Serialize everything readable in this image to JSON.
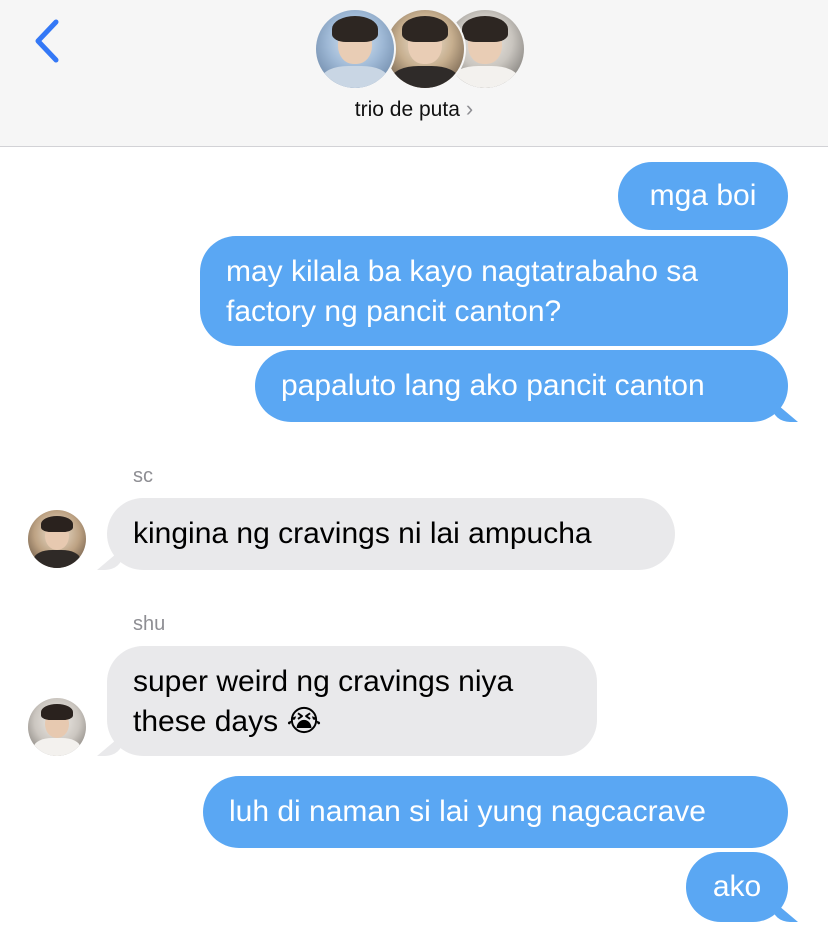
{
  "header": {
    "group_name": "trio de puta",
    "chevron": "›",
    "back_icon": "chevron-left-icon",
    "accent_color": "#3478f6"
  },
  "messages": [
    {
      "direction": "outgoing",
      "text": "mga boi"
    },
    {
      "direction": "outgoing",
      "lines": [
        "may kilala ba kayo nagtatrabaho sa",
        "factory ng pancit canton?"
      ]
    },
    {
      "direction": "outgoing",
      "text": "papaluto lang ako pancit canton"
    },
    {
      "direction": "incoming",
      "sender": "sc",
      "text": "kingina ng cravings ni lai ampucha"
    },
    {
      "direction": "incoming",
      "sender": "shu",
      "lines": [
        "super weird ng cravings niya",
        "these days"
      ],
      "emoji": "😭"
    },
    {
      "direction": "outgoing",
      "text": "luh di naman si lai yung nagcacrave"
    },
    {
      "direction": "outgoing",
      "text": "ako"
    }
  ],
  "colors": {
    "outgoing_bubble": "#5aa7f3",
    "incoming_bubble": "#e9e9eb",
    "header_bg": "#f6f6f6"
  }
}
